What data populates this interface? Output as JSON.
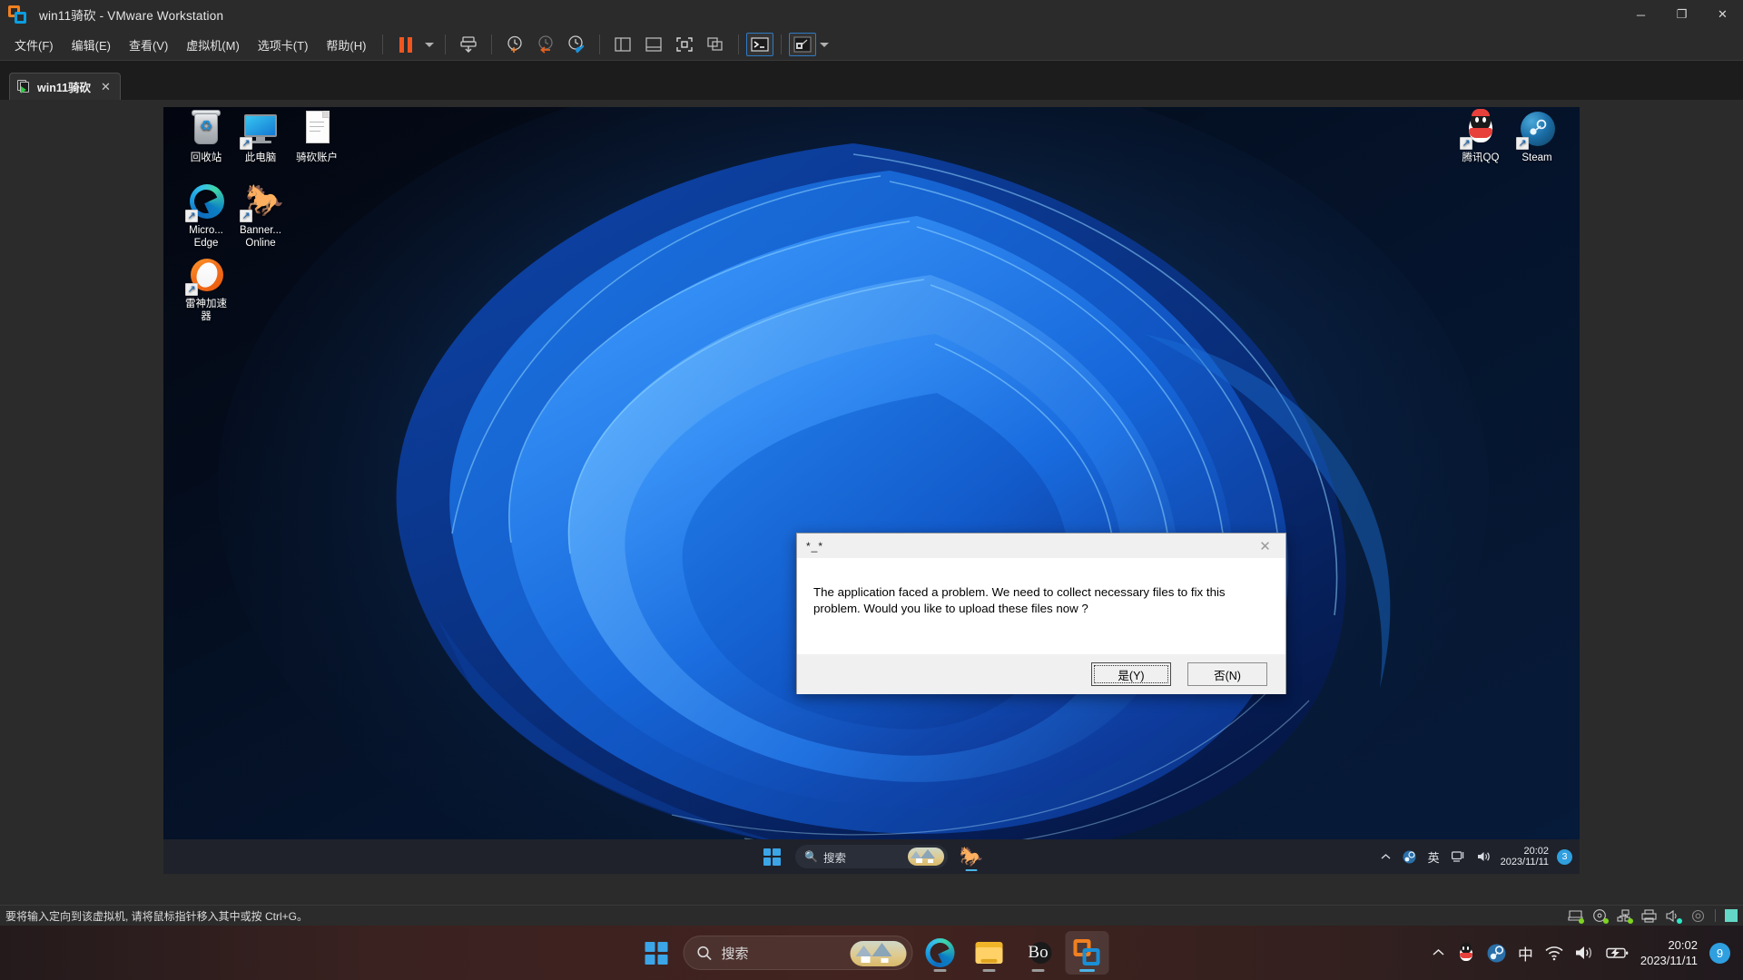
{
  "window": {
    "title": "win11骑砍 - VMware Workstation",
    "logo_icon": "vmware-logo-icon",
    "minimize_label": "─",
    "maximize_label": "❐",
    "close_label": "✕"
  },
  "menu": [
    {
      "label": "文件(F)",
      "name": "menu-file"
    },
    {
      "label": "编辑(E)",
      "name": "menu-edit"
    },
    {
      "label": "查看(V)",
      "name": "menu-view"
    },
    {
      "label": "虚拟机(M)",
      "name": "menu-vm"
    },
    {
      "label": "选项卡(T)",
      "name": "menu-tabs"
    },
    {
      "label": "帮助(H)",
      "name": "menu-help"
    }
  ],
  "toolbar": {
    "pause_icon": "pause-icon",
    "power_dropdown_icon": "chevron-down-icon",
    "send_ctrl_alt_del_icon": "send-keys-icon",
    "snapshot_take_icon": "take-snapshot-icon",
    "snapshot_revert_icon": "revert-snapshot-icon",
    "snapshot_manager_icon": "snapshot-manager-icon",
    "show_library_icon": "show-library-icon",
    "show_thumbnail_icon": "show-thumbnail-bar-icon",
    "fullscreen_icon": "enter-fullscreen-icon",
    "unity_icon": "unity-mode-icon",
    "console_icon": "console-view-icon",
    "remote_icon": "remote-device-icon",
    "remote_dropdown_icon": "chevron-down-icon"
  },
  "tab": {
    "label": "win11骑砍",
    "icon": "vm-running-icon",
    "close_label": "✕"
  },
  "desktop": {
    "icons": [
      {
        "name": "desktop-icon-recycle-bin",
        "label": "回收站",
        "glyph": "recycle-bin-icon",
        "shortcut": false
      },
      {
        "name": "desktop-icon-this-pc",
        "label": "此电脑",
        "glyph": "this-pc-icon",
        "shortcut": true
      },
      {
        "name": "desktop-icon-qikan-account",
        "label": "骑砍账户",
        "glyph": "document-icon",
        "shortcut": false
      },
      {
        "name": "desktop-icon-microsoft-edge",
        "label": "Micro...\nEdge",
        "label_line1": "Micro...",
        "label_line2": "Edge",
        "glyph": "edge-icon",
        "shortcut": true
      },
      {
        "name": "desktop-icon-bannerlord-online",
        "label_line1": "Banner...",
        "label_line2": "Online",
        "glyph": "horse-icon",
        "shortcut": true
      },
      {
        "name": "desktop-icon-leishen-accelerator",
        "label_line1": "雷神加速",
        "label_line2": "器",
        "glyph": "leishen-icon",
        "shortcut": true
      }
    ],
    "right_icons": [
      {
        "name": "desktop-icon-tencent-qq",
        "label": "腾讯QQ",
        "glyph": "qq-penguin-icon",
        "shortcut": true
      },
      {
        "name": "desktop-icon-steam",
        "label": "Steam",
        "glyph": "steam-icon",
        "shortcut": true
      }
    ]
  },
  "dialog": {
    "title": "*_*",
    "close_label": "✕",
    "message": "The application faced a problem. We need to collect necessary files to fix this problem. Would you like to upload these files now ?",
    "buttons": [
      {
        "name": "dialog-yes-button",
        "label": "是(Y)",
        "default": true
      },
      {
        "name": "dialog-no-button",
        "label": "否(N)",
        "default": false
      }
    ]
  },
  "guest_taskbar": {
    "start_icon": "windows-start-icon",
    "search_placeholder": "搜索",
    "search_icon": "search-icon",
    "apps": [
      {
        "name": "taskbar-app-bannerlord",
        "icon": "horse-icon",
        "running": true
      }
    ],
    "tray": {
      "overflow_icon": "chevron-up-icon",
      "steam_icon": "steam-icon",
      "ime_label": "英",
      "network_icon": "network-icon",
      "volume_icon": "volume-icon",
      "time": "20:02",
      "date": "2023/11/11",
      "notification_count": "3"
    }
  },
  "status_bar": {
    "message": "要将输入定向到该虚拟机, 请将鼠标指针移入其中或按 Ctrl+G。",
    "devices": [
      {
        "name": "status-hard-disk-icon",
        "icon": "hard-disk-icon",
        "state": "green"
      },
      {
        "name": "status-cd-dvd-icon",
        "icon": "cd-dvd-icon",
        "state": "green"
      },
      {
        "name": "status-network-icon",
        "icon": "network-adapter-icon",
        "state": "green"
      },
      {
        "name": "status-printer-icon",
        "icon": "printer-icon",
        "state": "none"
      },
      {
        "name": "status-sound-icon",
        "icon": "sound-card-icon",
        "state": "cyan"
      },
      {
        "name": "status-camera-icon",
        "icon": "camera-icon",
        "state": "none"
      }
    ],
    "message_indicator_icon": "message-indicator-icon"
  },
  "host_taskbar": {
    "start_icon": "windows-start-icon",
    "search_placeholder": "搜索",
    "search_icon": "search-icon",
    "apps": [
      {
        "name": "host-taskbar-app-edge",
        "icon": "edge-icon",
        "running": true,
        "active": false
      },
      {
        "name": "host-taskbar-app-file-explorer",
        "icon": "folder-icon",
        "running": true,
        "active": false
      },
      {
        "name": "host-taskbar-app-bo",
        "icon": "bo-icon",
        "label": "Bo",
        "running": true,
        "active": false
      },
      {
        "name": "host-taskbar-app-vmware",
        "icon": "vmware-logo-icon",
        "running": true,
        "active": true
      }
    ],
    "tray": {
      "overflow_icon": "chevron-up-icon",
      "qq_icon": "qq-penguin-icon",
      "steam_icon": "steam-icon",
      "ime_label": "中",
      "wifi_icon": "wifi-icon",
      "volume_icon": "volume-icon",
      "battery_icon": "battery-icon",
      "time": "20:02",
      "date": "2023/11/11",
      "notification_count": "9"
    }
  },
  "colors": {
    "vmware_chrome": "#2b2b2b",
    "accent_orange": "#f0561f",
    "accent_blue": "#2f7bc4",
    "win_accent": "#3ba5e8",
    "dialog_bg": "#f0f0f0"
  }
}
